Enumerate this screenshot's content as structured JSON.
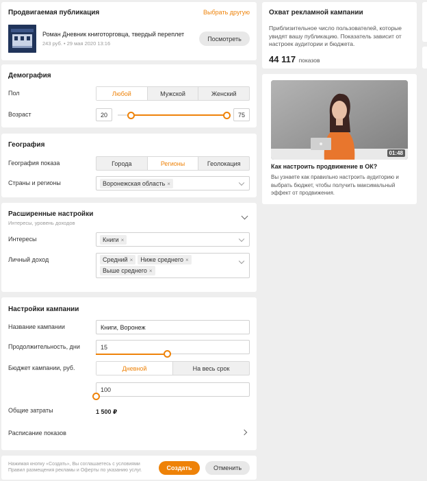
{
  "publication": {
    "title": "Продвигаемая публикация",
    "change_link": "Выбрать другую",
    "book_title": "Роман Дневник книготорговца, твердый переплет",
    "meta": "243 руб. • 29 мая 2020 13:16",
    "view_button": "Посмотреть"
  },
  "demography": {
    "title": "Демография",
    "gender_label": "Пол",
    "gender_options": [
      "Любой",
      "Мужской",
      "Женский"
    ],
    "age_label": "Возраст",
    "age_min": "20",
    "age_max": "75"
  },
  "geography": {
    "title": "География",
    "display_label": "География показа",
    "display_options": [
      "Города",
      "Регионы",
      "Геолокация"
    ],
    "regions_label": "Страны и регионы",
    "region_chip": "Воронежская область"
  },
  "advanced": {
    "title": "Расширенные настройки",
    "subtitle": "Интересы, уровень доходов",
    "interests_label": "Интересы",
    "interest_chip": "Книги",
    "income_label": "Личный доход",
    "income_chips": [
      "Средний",
      "Ниже среднего",
      "Выше среднего"
    ]
  },
  "campaign": {
    "title": "Настройки кампании",
    "name_label": "Название кампании",
    "name_value": "Книги, Воронеж",
    "duration_label": "Продолжительность, дни",
    "duration_value": "15",
    "duration_fraction": 0.46,
    "budget_label": "Бюджет кампании, руб.",
    "budget_options": [
      "Дневной",
      "На весь срок"
    ],
    "budget_value": "100",
    "budget_fraction": 0.0,
    "total_label": "Общие затраты",
    "total_value": "1 500 ₽",
    "schedule_label": "Расписание показов"
  },
  "footer": {
    "note_line1": "Нажимая кнопку «Создать», Вы соглашаетесь с условиями",
    "note_line2": "Правил размещения рекламы и Оферты по указанию услуг.",
    "create_button": "Создать",
    "cancel_button": "Отменить"
  },
  "reach": {
    "title": "Охват рекламной кампании",
    "description": "Приблизительное число пользователей, которые увидят вашу публикацию. Показатель зависит от настроек аудитории и бюджета.",
    "count": "44 117",
    "unit": "показов"
  },
  "video": {
    "duration": "01:48",
    "title": "Как настроить продвижение в ОК?",
    "description": "Вы узнаете как правильно настроить аудиторию и выбрать бюджет, чтобы получить максимальный эффект от продвижения."
  },
  "colors": {
    "accent": "#ee8208",
    "background": "#eeeeee"
  }
}
